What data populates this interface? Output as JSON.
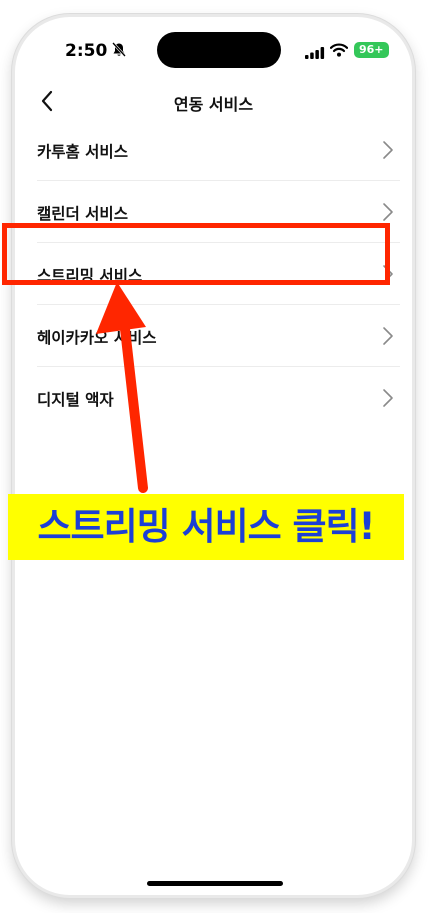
{
  "status_bar": {
    "time": "2:50",
    "battery": "96+"
  },
  "nav": {
    "title": "연동 서비스"
  },
  "menu": {
    "items": [
      {
        "label": "카투홈 서비스"
      },
      {
        "label": "캘린더 서비스"
      },
      {
        "label": "스트리밍 서비스"
      },
      {
        "label": "헤이카카오 서비스"
      },
      {
        "label": "디지털 액자"
      }
    ]
  },
  "annotation": {
    "text": "스트리밍 서비스 클릭!",
    "highlight_color": "#ff2600",
    "banner_color": "#ffff00",
    "text_color": "#1c3fd6"
  }
}
